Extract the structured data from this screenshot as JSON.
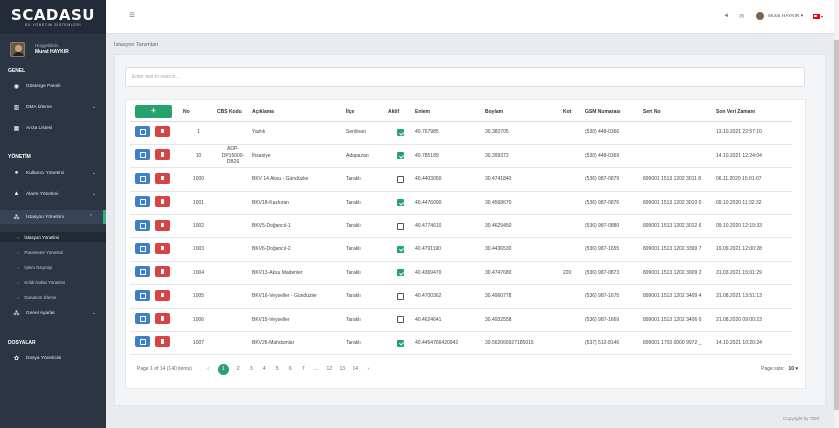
{
  "brand": {
    "logo": "SCADASU",
    "logo_sub": "SU YÖNETİM SİSTEMLERİ"
  },
  "user": {
    "greeting": "Hoşgeldiniz,",
    "name": "Murat HAYKIR"
  },
  "sidebar": {
    "section_general": "GENEL",
    "dashboard": "Gösterge Paneli",
    "dma": "DMA İzleme",
    "alarm_list": "Arıza Listesi",
    "section_management": "YÖNETİM",
    "user_mgmt": "Kullanıcı Yönetimi",
    "alarm_mgmt": "Alarm Yönetimi",
    "station_mgmt": "İstasyon Yönetimi",
    "sub": [
      "İstasyon Yönetimi",
      "Parametre Yönetimi",
      "İşlem Geçmişi",
      "Kritik Nokta Yönetimi",
      "Donanım İzleme"
    ],
    "general_settings": "Genel Ayarlar",
    "section_files": "DOSYALAR",
    "file_mgmt": "Dosya Yöneticisi"
  },
  "topbar": {
    "user_name": "Murat HAYKIR ▾",
    "chev": "▾"
  },
  "breadcrumb": "İstasyon Tanımları",
  "search": {
    "placeholder": "Enter text to search..."
  },
  "table": {
    "add_label": "+",
    "headers": [
      "No",
      "CBS Kodu",
      "Açıklama",
      "İlçe",
      "Aktif",
      "Enlem",
      "Boylam",
      "Kot",
      "GSM Numarası",
      "Seri No",
      "Son Veri Zamanı"
    ],
    "rows": [
      {
        "no": "1",
        "cbs": "",
        "desc": "Yazlık",
        "ilce": "Serdivan",
        "aktif": true,
        "enlem": "40.767985",
        "boylam": "30.382705",
        "kot": "",
        "gsm": "(530) 448-0366",
        "seri": "",
        "son": "13.10.2021 22:57:10"
      },
      {
        "no": "10",
        "cbs": "ADP-DP15000-DB26",
        "desc": "İhsaniye",
        "ilce": "Adapazarı",
        "aktif": true,
        "enlem": "40.785189",
        "boylam": "30.399372",
        "kot": "",
        "gsm": "(530) 448-0369",
        "seri": "",
        "son": "14.10.2021 12:24:04"
      },
      {
        "no": "1000",
        "cbs": "",
        "desc": "BKV 14 Aksu - Gündüzke",
        "ilce": "Taraklı",
        "aktif": false,
        "enlem": "40.4403050",
        "boylam": "30.4741840",
        "kot": "",
        "gsm": "(536) 987-0879",
        "seri": "899001 1513 1202 3011 8",
        "son": "06.11.2020 15:01:07"
      },
      {
        "no": "1001",
        "cbs": "",
        "desc": "BKV18-Kazkıran",
        "ilce": "Taraklı",
        "aktif": true,
        "enlem": "40.4476090",
        "boylam": "30.4568670",
        "kot": "",
        "gsm": "(536) 987-0876",
        "seri": "899001 1513 1202 3010 0",
        "son": "09.10.2020 11:32:32"
      },
      {
        "no": "1002",
        "cbs": "",
        "desc": "BKV5-Doğancıl-1",
        "ilce": "Taraklı",
        "aktif": false,
        "enlem": "40.4774610",
        "boylam": "30.4629450",
        "kot": "",
        "gsm": "(536) 987-0880",
        "seri": "899001 1513 1202 3012 6",
        "son": "09.10.2020 12:19:33"
      },
      {
        "no": "1003",
        "cbs": "",
        "desc": "BKV6-Doğancıl-2",
        "ilce": "Taraklı",
        "aktif": true,
        "enlem": "40.4791190",
        "boylam": "30.4436530",
        "kot": "",
        "gsm": "(536) 987-1655",
        "seri": "899001 1513 1202 3399 7",
        "son": "19.09.2021 12:00:28"
      },
      {
        "no": "1004",
        "cbs": "",
        "desc": "BKV13-Aksu Madenler",
        "ilce": "Taraklı",
        "aktif": true,
        "enlem": "40.4369470",
        "boylam": "30.4747680",
        "kot": "220",
        "gsm": "(536) 987-0873",
        "seri": "899001 1513 1202 3009 2",
        "son": "31.03.2021 15:01:29"
      },
      {
        "no": "1005",
        "cbs": "",
        "desc": "BKV16-Veyseller - Gündüzler",
        "ilce": "Taraklı",
        "aktif": false,
        "enlem": "40.4700362",
        "boylam": "30.4960778",
        "kot": "",
        "gsm": "(536) 987-1675",
        "seri": "899001 1513 1202 3409 4",
        "son": "31.08.2021 13:51:13"
      },
      {
        "no": "1006",
        "cbs": "",
        "desc": "BKV15-Veyseller",
        "ilce": "Taraklı",
        "aktif": false,
        "enlem": "40.4624641",
        "boylam": "30.4932558",
        "kot": "",
        "gsm": "(536) 987-1669",
        "seri": "899001 1513 1202 3406 0",
        "son": "21.08.2020 09:00:23"
      },
      {
        "no": "1007",
        "cbs": "",
        "desc": "BKV26-Mahdumlar",
        "ilce": "Taraklı",
        "aktif": true,
        "enlem": "40.4454766420942",
        "boylam": "30.562066927185015",
        "kot": "",
        "gsm": "(537) 512-8146",
        "seri": "899001 1703 0000 9972 _",
        "son": "14.10.2021 10:20:24"
      }
    ]
  },
  "pager": {
    "info": "Page 1 of 14 (140 items)",
    "prev": "‹",
    "pages": [
      "1",
      "2",
      "3",
      "4",
      "5",
      "6",
      "7",
      "...",
      "12",
      "13",
      "14"
    ],
    "next": "›",
    "current": "1",
    "size_label": "Page size:",
    "size_value": "10 ▾"
  },
  "footer": "Copyright by TBM",
  "icons": {
    "menu": "hamburger-icon",
    "flag": "turkey-flag-icon"
  },
  "colors": {
    "sidebar": "#2c3544",
    "accent": "#28a26d",
    "edit": "#3f7fc6",
    "delete": "#d64545"
  }
}
